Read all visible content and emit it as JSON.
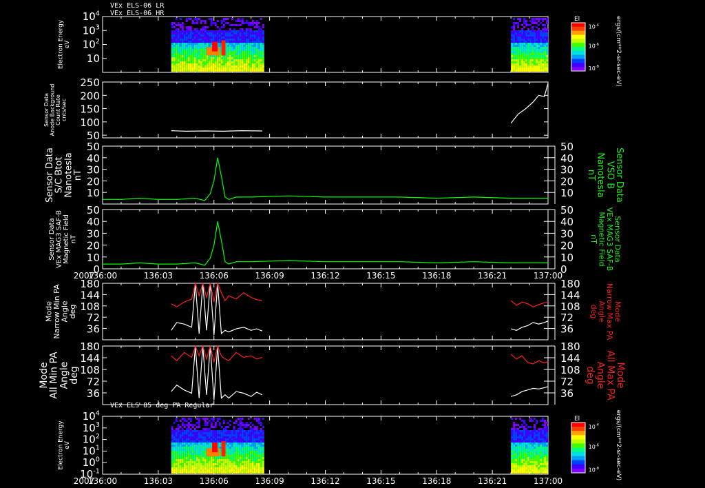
{
  "chart_data": [
    {
      "type": "heatmap",
      "titles": [
        "VEx ELS-06 LR",
        "VEx ELS-06 HR"
      ],
      "ylabel": [
        "Electron Energy",
        "eV"
      ],
      "yscale": "log",
      "ylim": [
        1,
        10000
      ],
      "ticks": [
        {
          "v": 10000,
          "base": "10",
          "exp": "4"
        },
        {
          "v": 1000,
          "base": "10",
          "exp": "3"
        },
        {
          "v": 100,
          "base": "10",
          "exp": "2"
        },
        {
          "v": 10,
          "base": "10",
          "exp": ""
        }
      ],
      "data_intervals": [
        {
          "x0": 3.7,
          "x1": 8.6
        },
        {
          "x0": 22.0,
          "x1": 23.9
        }
      ],
      "colorbar": {
        "label": "El",
        "unit": "ergs/(cm**2-sr-sec-eV)",
        "ticks": [
          {
            "base": "10",
            "exp": "-4"
          },
          {
            "base": "10",
            "exp": "-6"
          },
          {
            "base": "10",
            "exp": "-8"
          }
        ]
      }
    },
    {
      "type": "line",
      "ylabel": [
        "Sensor Data",
        "Anode Background",
        "Count Rate",
        "cnts/sec"
      ],
      "ylim": [
        40,
        250
      ],
      "ticks": [
        250,
        200,
        150,
        100,
        50
      ],
      "series": [
        {
          "color": "#ffffff",
          "segments": [
            {
              "x": [
                3.7,
                4.5,
                5.5,
                6.5,
                7.5,
                8.6
              ],
              "y": [
                67,
                65,
                66,
                65,
                67,
                66
              ]
            },
            {
              "x": [
                22.0,
                22.4,
                22.8,
                23.2,
                23.5,
                23.8,
                24.0
              ],
              "y": [
                95,
                130,
                150,
                175,
                200,
                195,
                245
              ]
            }
          ]
        }
      ]
    },
    {
      "type": "line",
      "ylabel": [
        "Sensor Data",
        "S/C Btot",
        "Nanotesla",
        "nT"
      ],
      "ylabel_right": [
        "Sensor Data",
        "VSO B",
        "Nanotesla",
        "nT"
      ],
      "ylim": [
        0,
        50
      ],
      "ticks": [
        50,
        40,
        30,
        20,
        10
      ],
      "series": [
        {
          "color": "#00ff00",
          "x": [
            0,
            1,
            2,
            3,
            4,
            5,
            5.5,
            5.8,
            6.0,
            6.2,
            6.4,
            6.6,
            6.8,
            7.2,
            8,
            10,
            12,
            14,
            16,
            18,
            20,
            22,
            24
          ],
          "y": [
            4,
            4,
            5,
            4,
            4,
            5,
            3,
            9,
            20,
            40,
            24,
            6,
            4,
            6,
            6,
            7,
            6,
            6,
            6,
            5,
            6,
            5,
            5
          ]
        }
      ]
    },
    {
      "type": "line",
      "ylabel": [
        "Sensor Data",
        "VEx MAG3 SAF-B",
        "Magnetic Field",
        "nT"
      ],
      "ylabel_right": [
        "Sensor Data",
        "VEx MAG3 SAF-B",
        "Magnetic Field",
        "nT"
      ],
      "ylim": [
        0,
        50
      ],
      "ticks": [
        50,
        40,
        30,
        20,
        10,
        0
      ],
      "series": [
        {
          "color": "#00ff00",
          "x": [
            0,
            1,
            2,
            3,
            4,
            5,
            5.5,
            5.8,
            6.0,
            6.2,
            6.4,
            6.6,
            6.8,
            7.2,
            8,
            10,
            12,
            14,
            16,
            18,
            20,
            22,
            24
          ],
          "y": [
            4,
            4,
            5,
            4,
            4,
            5,
            3,
            9,
            20,
            40,
            24,
            6,
            4,
            6,
            6,
            7,
            6,
            6,
            6,
            5,
            6,
            5,
            5
          ]
        }
      ]
    },
    {
      "type": "line",
      "ylabel": [
        "Mode",
        "Narrow Min PA",
        "Angle",
        "deg"
      ],
      "ylabel_right": [
        "Mode",
        "Narrow Max PA",
        "Angle",
        "deg"
      ],
      "ylim": [
        0,
        180
      ],
      "ticks": [
        180,
        144,
        108,
        72,
        36
      ],
      "series": [
        {
          "color": "#ffffff",
          "segments": [
            {
              "x": [
                3.7,
                4.0,
                4.4,
                4.8,
                5.0,
                5.2,
                5.4,
                5.6,
                5.8,
                6.0,
                6.2,
                6.4,
                6.6,
                6.8,
                7.2,
                7.6,
                8.0,
                8.3,
                8.6
              ],
              "y": [
                30,
                55,
                50,
                40,
                180,
                20,
                180,
                30,
                180,
                15,
                180,
                20,
                30,
                25,
                35,
                40,
                30,
                35,
                28
              ]
            },
            {
              "x": [
                22.0,
                22.3,
                22.6,
                22.9,
                23.2,
                23.5,
                23.8,
                24.0
              ],
              "y": [
                35,
                30,
                40,
                45,
                55,
                50,
                55,
                60
              ]
            }
          ]
        },
        {
          "color": "#ff2020",
          "segments": [
            {
              "x": [
                3.7,
                4.0,
                4.4,
                4.8,
                5.0,
                5.2,
                5.4,
                5.6,
                5.8,
                6.0,
                6.2,
                6.4,
                6.6,
                6.8,
                7.2,
                7.6,
                8.0,
                8.3,
                8.6
              ],
              "y": [
                115,
                105,
                120,
                130,
                180,
                140,
                180,
                135,
                180,
                120,
                180,
                150,
                125,
                140,
                130,
                150,
                135,
                128,
                125
              ]
            },
            {
              "x": [
                22.0,
                22.3,
                22.6,
                22.9,
                23.2,
                23.5,
                23.8,
                24.0
              ],
              "y": [
                125,
                110,
                120,
                115,
                105,
                112,
                118,
                120
              ]
            }
          ]
        }
      ]
    },
    {
      "type": "line",
      "ylabel": [
        "Mode",
        "All Min PA",
        "Angle",
        "deg"
      ],
      "ylabel_right": [
        "Mode",
        "All Max PA",
        "Angle",
        "deg"
      ],
      "ylim": [
        0,
        180
      ],
      "ticks": [
        180,
        144,
        108,
        72,
        36
      ],
      "series": [
        {
          "color": "#ffffff",
          "segments": [
            {
              "x": [
                3.7,
                4.0,
                4.4,
                4.8,
                5.0,
                5.2,
                5.4,
                5.6,
                5.8,
                6.0,
                6.2,
                6.4,
                6.6,
                6.8,
                7.2,
                7.6,
                8.0,
                8.3,
                8.6
              ],
              "y": [
                40,
                60,
                45,
                35,
                180,
                20,
                180,
                30,
                180,
                15,
                180,
                20,
                30,
                20,
                40,
                35,
                25,
                38,
                30
              ]
            },
            {
              "x": [
                22.0,
                22.3,
                22.6,
                22.9,
                23.2,
                23.5,
                23.8,
                24.0
              ],
              "y": [
                25,
                30,
                40,
                45,
                50,
                48,
                52,
                55
              ]
            }
          ]
        },
        {
          "color": "#ff2020",
          "segments": [
            {
              "x": [
                3.7,
                4.0,
                4.4,
                4.8,
                5.0,
                5.2,
                5.4,
                5.6,
                5.8,
                6.0,
                6.2,
                6.4,
                6.6,
                6.8,
                7.2,
                7.6,
                8.0,
                8.3,
                8.6
              ],
              "y": [
                150,
                135,
                160,
                145,
                180,
                150,
                180,
                140,
                180,
                130,
                180,
                150,
                140,
                135,
                160,
                145,
                150,
                140,
                145
              ]
            },
            {
              "x": [
                22.0,
                22.3,
                22.6,
                22.9,
                23.2,
                23.5,
                23.8,
                24.0
              ],
              "y": [
                155,
                140,
                150,
                130,
                125,
                135,
                128,
                132
              ]
            }
          ]
        }
      ]
    },
    {
      "type": "heatmap",
      "titles": [
        "VEx ELS 85 deg PA Regular"
      ],
      "ylabel": [
        "Electron Energy",
        "eV"
      ],
      "yscale": "log",
      "ylim": [
        0.1,
        10000
      ],
      "ticks": [
        {
          "v": 10000,
          "base": "10",
          "exp": "4"
        },
        {
          "v": 1000,
          "base": "10",
          "exp": "3"
        },
        {
          "v": 100,
          "base": "10",
          "exp": "2"
        },
        {
          "v": 10,
          "base": "10",
          "exp": "1"
        },
        {
          "v": 1,
          "base": "10",
          "exp": "0"
        },
        {
          "v": 0.1,
          "base": "10",
          "exp": "-1"
        }
      ],
      "data_intervals": [
        {
          "x0": 3.7,
          "x1": 8.6
        },
        {
          "x0": 22.0,
          "x1": 23.9
        }
      ],
      "colorbar": {
        "label": "El",
        "unit": "ergs/(cm**2-sr-sec-eV)",
        "ticks": [
          {
            "base": "10",
            "exp": "-4"
          },
          {
            "base": "10",
            "exp": "-6"
          },
          {
            "base": "10",
            "exp": "-8"
          }
        ]
      }
    }
  ],
  "time_axis": {
    "range": [
      0,
      24
    ],
    "year": "2007",
    "ticks": [
      {
        "v": 0,
        "label": "136:00"
      },
      {
        "v": 3,
        "label": "136:03"
      },
      {
        "v": 6,
        "label": "136:06"
      },
      {
        "v": 9,
        "label": "136:09"
      },
      {
        "v": 12,
        "label": "136:12"
      },
      {
        "v": 15,
        "label": "136:15"
      },
      {
        "v": 18,
        "label": "136:18"
      },
      {
        "v": 21,
        "label": "136:21"
      },
      {
        "v": 24,
        "label": "137:00"
      }
    ]
  }
}
